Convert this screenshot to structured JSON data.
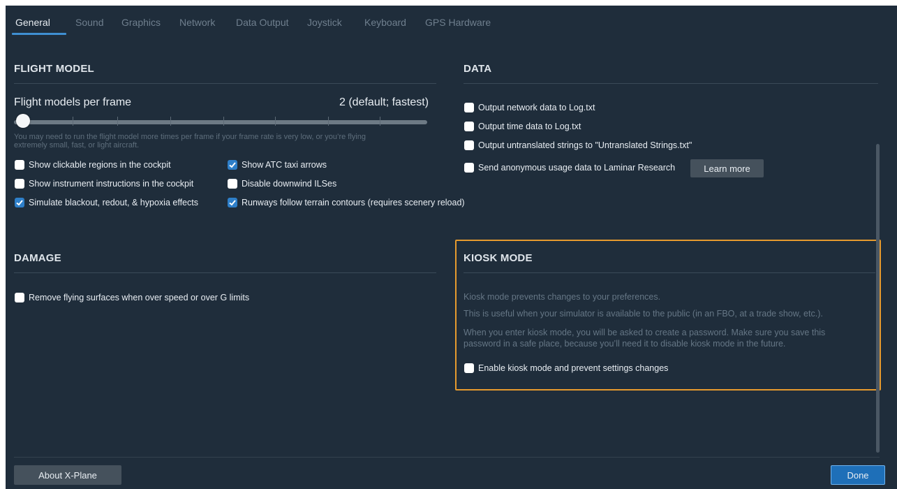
{
  "tabs": [
    {
      "label": "General"
    },
    {
      "label": "Sound"
    },
    {
      "label": "Graphics"
    },
    {
      "label": "Network"
    },
    {
      "label": "Data Output"
    },
    {
      "label": "Joystick"
    },
    {
      "label": "Keyboard"
    },
    {
      "label": "GPS Hardware"
    }
  ],
  "active_tab": "General",
  "flight_model": {
    "title": "FLIGHT MODEL",
    "slider_label": "Flight models per frame",
    "slider_value_text": "2 (default; fastest)",
    "slider_level": 0,
    "note_line1": "You may need to run the flight model more times per frame if your frame rate is very low, or you’re flying",
    "note_line2": "extremely small, fast, or light aircraft.",
    "checkboxes": [
      {
        "label": "Show clickable regions in the cockpit",
        "checked": false
      },
      {
        "label": "Show ATC taxi arrows",
        "checked": true
      },
      {
        "label": "Show instrument instructions in the cockpit",
        "checked": false
      },
      {
        "label": "Disable downwind ILSes",
        "checked": false
      },
      {
        "label": "Simulate blackout, redout, & hypoxia effects",
        "checked": true
      },
      {
        "label": "Runways follow terrain contours (requires scenery reload)",
        "checked": true
      }
    ]
  },
  "data": {
    "title": "DATA",
    "checkboxes": [
      {
        "label": "Output network data to Log.txt",
        "checked": false
      },
      {
        "label": "Output time data to Log.txt",
        "checked": false
      },
      {
        "label": "Output untranslated strings to \"Untranslated Strings.txt\"",
        "checked": false
      },
      {
        "label": "Send anonymous usage data to Laminar Research",
        "checked": false
      }
    ],
    "learn_more_label": "Learn more"
  },
  "damage": {
    "title": "DAMAGE",
    "checkboxes": [
      {
        "label": "Remove flying surfaces when over speed or over G limits",
        "checked": false
      }
    ]
  },
  "kiosk": {
    "title": "KIOSK MODE",
    "text1": "Kiosk mode prevents changes to your preferences.",
    "text2": "This is useful when your simulator is available to the public (in an FBO, at a trade show, etc.).",
    "text3_line1": "When you enter kiosk mode, you will be asked to create a password. Make sure you save this",
    "text3_line2": "password in a safe place, because you’ll need it to disable kiosk mode in the future.",
    "checkbox": {
      "label": "Enable kiosk mode and prevent settings changes",
      "checked": false
    }
  },
  "footer": {
    "about_label": "About X-Plane",
    "done_label": "Done"
  },
  "colors": {
    "background": "#1f2d3b",
    "accent": "#3f8fd1",
    "highlight_border": "#e69a2e"
  }
}
